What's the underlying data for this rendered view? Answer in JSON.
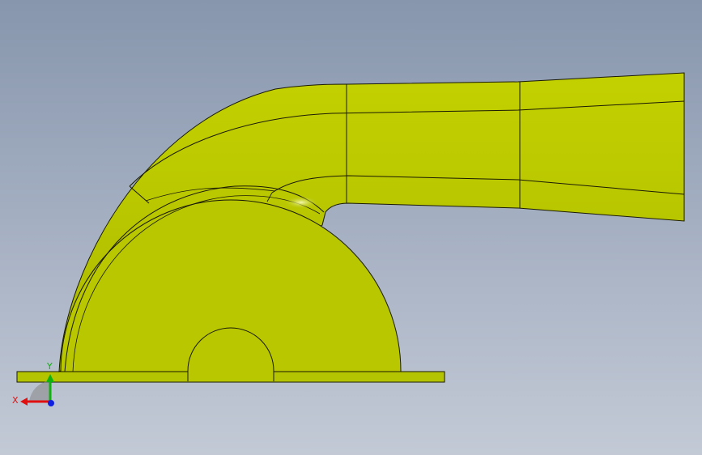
{
  "colors": {
    "part_fill": "#b5c400",
    "part_dark": "#9aa700",
    "part_highlight": "#e6f060",
    "edge": "#1a1a00",
    "axis_x": "#e01010",
    "axis_y": "#10b010",
    "axis_z": "#1020e0"
  },
  "triad": {
    "x_label": "X",
    "y_label": "Y"
  },
  "icons": {
    "triad": "coordinate-triad-icon"
  }
}
